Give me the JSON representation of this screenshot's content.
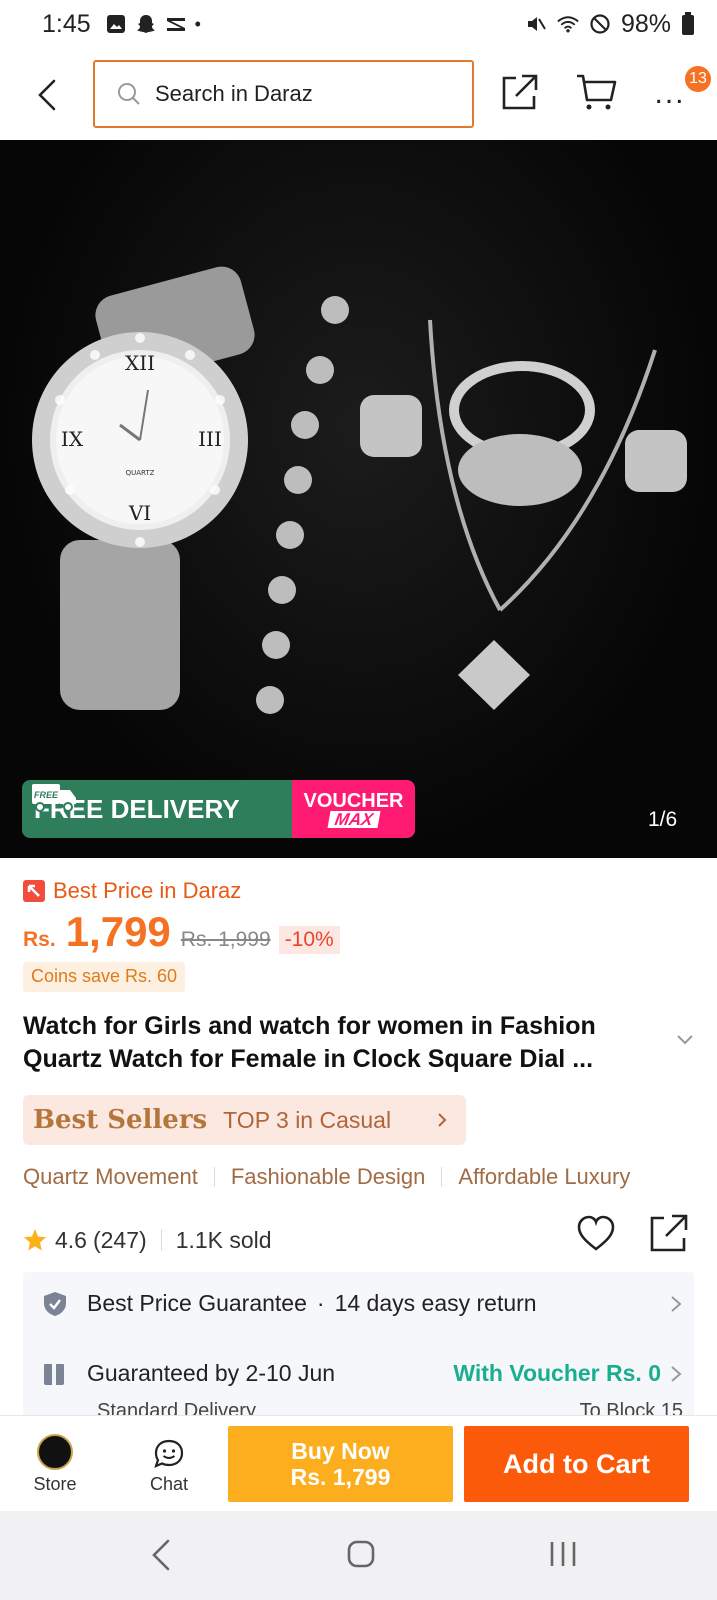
{
  "status": {
    "time": "1:45",
    "battery": "98%"
  },
  "header": {
    "search_placeholder": "Search in Daraz",
    "cart_badge": "13",
    "more_label": "..."
  },
  "hero": {
    "promo_free": "FREE DELIVERY",
    "promo_free_tag": "FREE",
    "promo_voucher_line1": "VOUCHER",
    "promo_voucher_line2": "MAX",
    "image_counter": "1/6",
    "dial_text": "QUARTZ"
  },
  "product": {
    "best_price_label": "Best Price in Daraz",
    "currency": "Rs.",
    "price": "1,799",
    "original_price": "Rs. 1,999",
    "discount": "-10%",
    "coins_save": "Coins save Rs. 60",
    "title": "Watch for Girls and watch for women in Fashion Quartz Watch for Female in Clock Square Dial ...",
    "best_sellers_label": "Best Sellers",
    "best_sellers_rank": "TOP 3 in Casual",
    "features": [
      "Quartz Movement",
      "Fashionable Design",
      "Affordable Luxury"
    ],
    "rating": "4.6",
    "rating_count": "(247)",
    "sold": "1.1K sold"
  },
  "service": {
    "guarantee": "Best Price Guarantee",
    "return_policy": "14 days easy return",
    "delivery_date": "Guaranteed by 2-10 Jun",
    "voucher": "With Voucher Rs. 0",
    "delivery_type": "Standard Delivery",
    "destination": "To Block 15"
  },
  "actions": {
    "store_label": "Store",
    "chat_label": "Chat",
    "buy_now_line1": "Buy Now",
    "buy_now_line2": "Rs. 1,799",
    "add_to_cart": "Add to Cart"
  },
  "colors": {
    "accent_orange": "#f57224",
    "buy_now": "#fcae1f",
    "add_to_cart": "#fc5a0b",
    "free_delivery_green": "#2e7d5b",
    "voucher_pink": "#ff1a72",
    "voucher_teal": "#1aae91"
  }
}
